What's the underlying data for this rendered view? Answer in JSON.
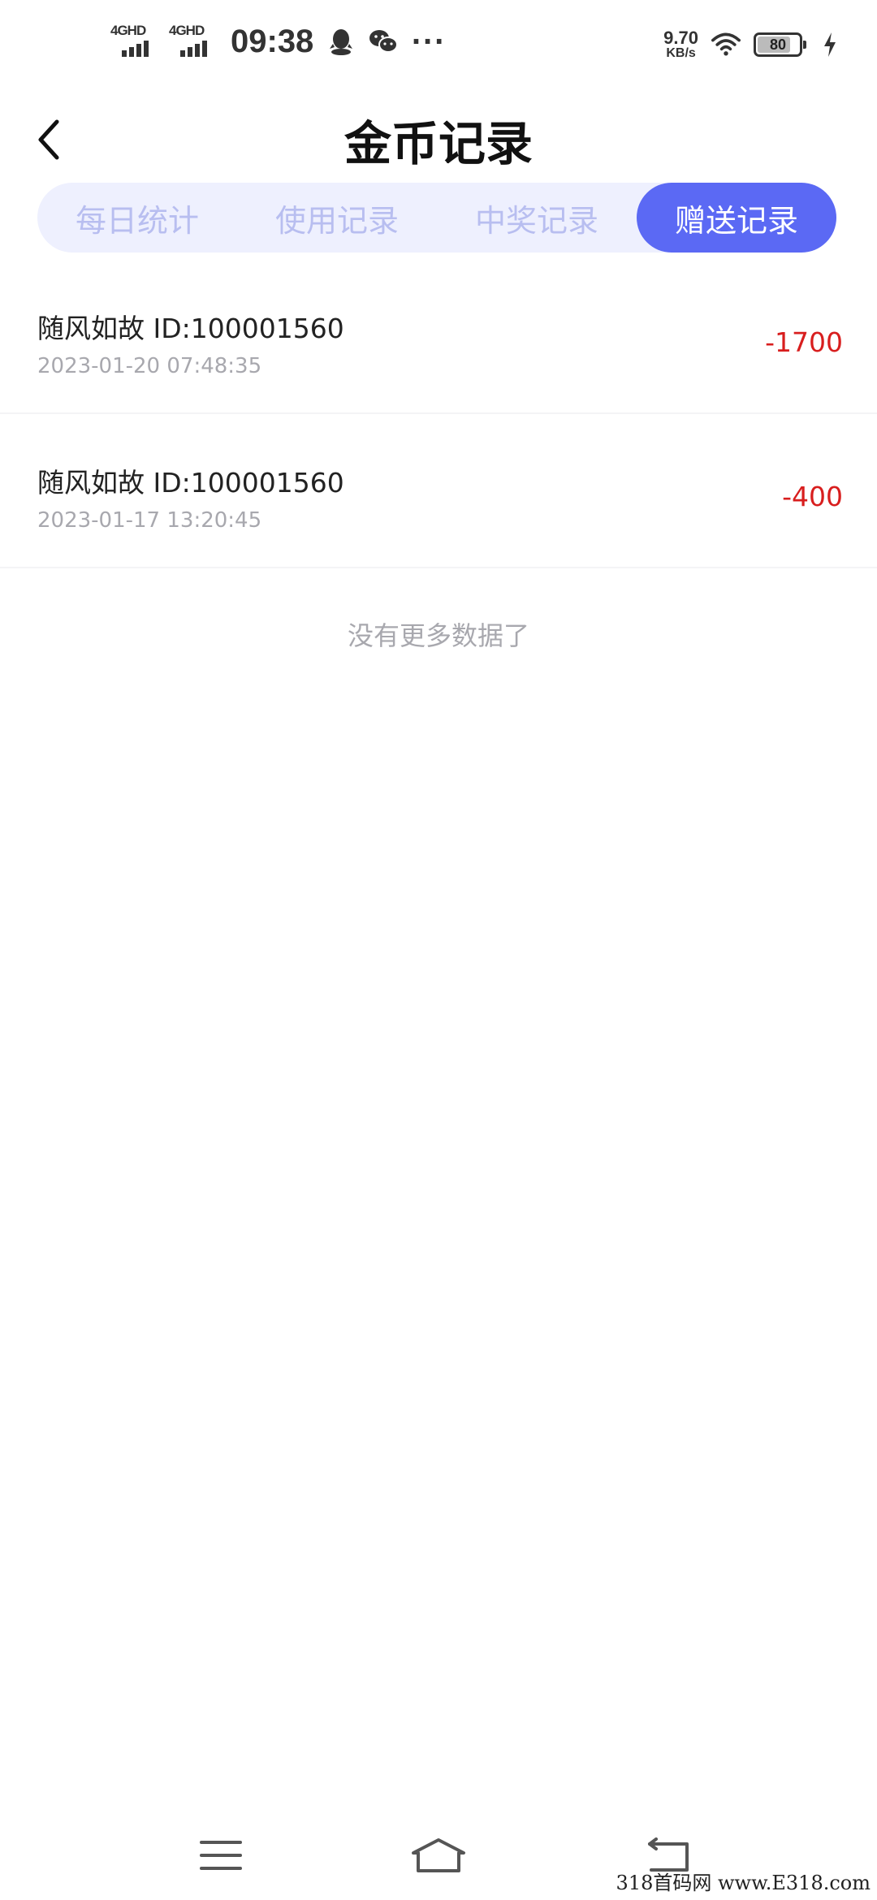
{
  "status_bar": {
    "sim1_label": "4GHD",
    "sim2_label": "4GHD",
    "time": "09:38",
    "more_dots": "···",
    "net_speed_value": "9.70",
    "net_speed_unit": "KB/s",
    "battery_level": "80",
    "battery_fraction": 0.8
  },
  "header": {
    "title": "金币记录"
  },
  "tabs": [
    {
      "label": "每日统计",
      "active": false
    },
    {
      "label": "使用记录",
      "active": false
    },
    {
      "label": "中奖记录",
      "active": false
    },
    {
      "label": "赠送记录",
      "active": true
    }
  ],
  "records": [
    {
      "name": "随风如故 ID:100001560",
      "time": "2023-01-20 07:48:35",
      "amount": "-1700"
    },
    {
      "name": "随风如故 ID:100001560",
      "time": "2023-01-17 13:20:45",
      "amount": "-400"
    }
  ],
  "list_footer": "没有更多数据了",
  "watermark": "318首码网 www.E318.com",
  "colors": {
    "accent": "#5b69f4",
    "tab_bg": "#eef0fe",
    "negative_amount": "#d81e1e"
  }
}
